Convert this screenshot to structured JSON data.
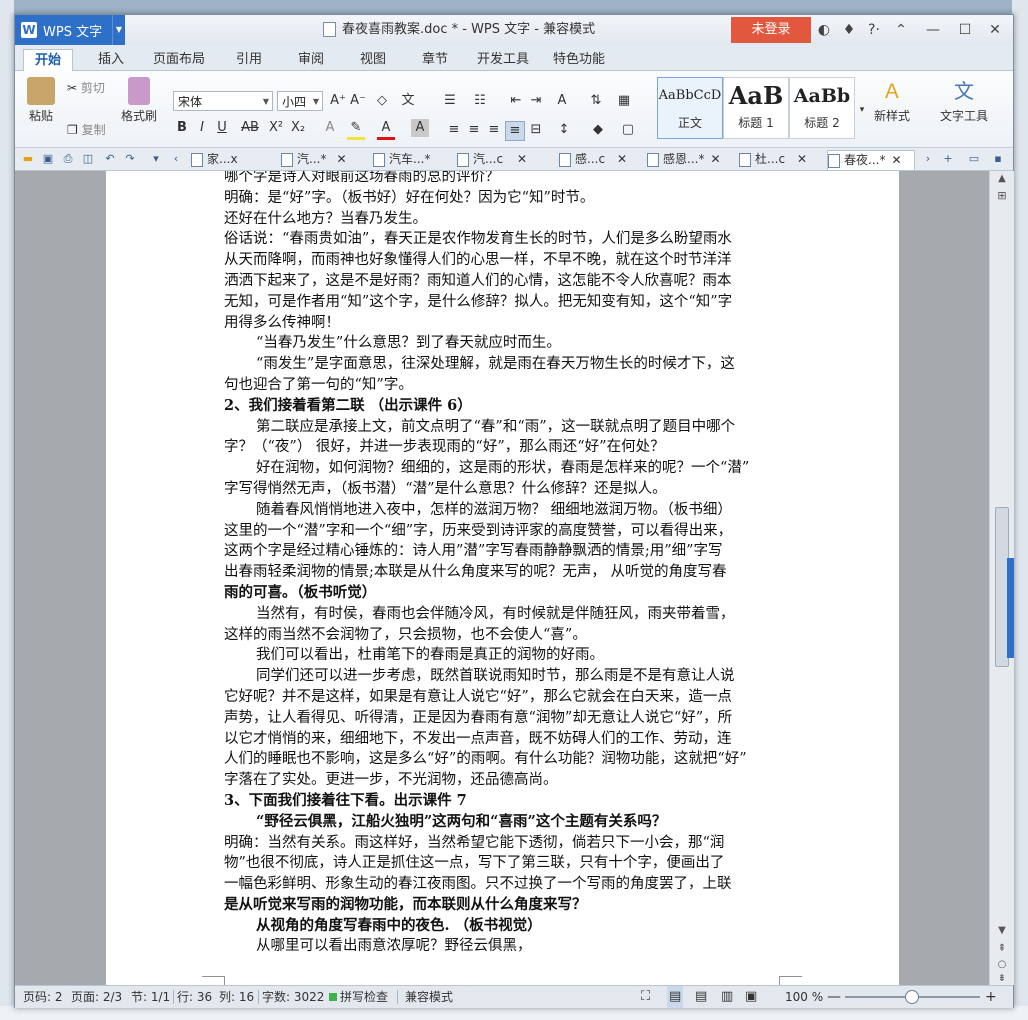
{
  "titlebar": {
    "app_name": "WPS 文字",
    "document_title": "春夜喜雨教案.doc * - WPS 文字 - 兼容模式",
    "login_label": "未登录"
  },
  "ribbon_tabs": [
    "开始",
    "插入",
    "页面布局",
    "引用",
    "审阅",
    "视图",
    "章节",
    "开发工具",
    "特色功能"
  ],
  "ribbon": {
    "paste": "粘贴",
    "cut": "剪切",
    "copy": "复制",
    "format_painter": "格式刷",
    "font_name": "宋体",
    "font_size": "小四",
    "styles": [
      {
        "sample": "AaBbCcD",
        "name": "正文"
      },
      {
        "sample": "AaB",
        "name": "标题 1"
      },
      {
        "sample": "AaBb",
        "name": "标题 2"
      }
    ],
    "new_style": "新样式",
    "text_tools": "文字工具"
  },
  "doc_tabs": [
    "家...x",
    "汽...*",
    "汽车...*",
    "汽...c",
    "感...c",
    "感恩...*",
    "杜...c",
    "春夜...*"
  ],
  "document": {
    "lines": [
      {
        "t": "哪个字是诗人对眼前这场春雨的总的评价？",
        "cls": ""
      },
      {
        "t": " 明确：是“好”字。（板书好）好在何处？因为它“知”时节。",
        "cls": ""
      },
      {
        "t": "还好在什么地方？当春乃发生。",
        "cls": ""
      },
      {
        "t": "俗话说：“春雨贵如油”，春天正是农作物发育生长的时节，人们是多么盼望雨水",
        "cls": ""
      },
      {
        "t": "从天而降啊，而雨神也好象懂得人们的心思一样，不早不晚，就在这个时节洋洋",
        "cls": ""
      },
      {
        "t": "洒洒下起来了，这是不是好雨？雨知道人们的心情，这怎能不令人欣喜呢？雨本",
        "cls": ""
      },
      {
        "t": "无知，可是作者用“知”这个字，是什么修辞？拟人。把无知变有知，这个“知”字",
        "cls": ""
      },
      {
        "t": "用得多么传神啊！",
        "cls": ""
      },
      {
        "t": "“当春乃发生”什么意思？到了春天就应时而生。",
        "cls": "ind"
      },
      {
        "t": "“雨发生”是字面意思，往深处理解，就是雨在春天万物生长的时候才下，这",
        "cls": "ind"
      },
      {
        "t": "句也迎合了第一句的“知”字。",
        "cls": ""
      },
      {
        "t": "2、我们接着看第二联 （出示课件 6）",
        "cls": "b"
      },
      {
        "t": "第二联应是承接上文，前文点明了“春”和“雨”，这一联就点明了题目中哪个",
        "cls": "ind"
      },
      {
        "t": "字？（“夜”）  很好，并进一步表现雨的“好”，那么雨还“好”在何处？",
        "cls": ""
      },
      {
        "t": "好在润物，如何润物？细细的，这是雨的形状，春雨是怎样来的呢？一个“潜”",
        "cls": "ind"
      },
      {
        "t": "字写得悄然无声，（板书潜）“潜”是什么意思？什么修辞？还是拟人。",
        "cls": ""
      },
      {
        "t": "随着春风悄悄地进入夜中，怎样的滋润万物？ 细细地滋润万物。（板书细）",
        "cls": "ind"
      },
      {
        "t": "这里的一个“潜”字和一个“细”字，历来受到诗评家的高度赞誉，可以看得出来，",
        "cls": ""
      },
      {
        "t": "这两个字是经过精心锤炼的：诗人用”潜”字写春雨静静飘洒的情景;用”细”字写",
        "cls": ""
      },
      {
        "t": "出春雨轻柔润物的情景;本联是从什么角度来写的呢？无声， 从听觉的角度写春",
        "cls": ""
      },
      {
        "t": "雨的可喜。（板书听觉）",
        "cls": "b"
      },
      {
        "t": "当然有，有时侯，春雨也会伴随冷风，有时候就是伴随狂风，雨夹带着雪，",
        "cls": "ind"
      },
      {
        "t": "这样的雨当然不会润物了，只会损物，也不会使人“喜”。",
        "cls": ""
      },
      {
        "t": "我们可以看出，杜甫笔下的春雨是真正的润物的好雨。",
        "cls": "ind"
      },
      {
        "t": "同学们还可以进一步考虑，既然首联说雨知时节，那么雨是不是有意让人说",
        "cls": "ind"
      },
      {
        "t": "它好呢？并不是这样，如果是有意让人说它“好”，那么它就会在白天来，造一点",
        "cls": ""
      },
      {
        "t": "声势，让人看得见、听得清，正是因为春雨有意“润物”却无意让人说它“好”，所",
        "cls": ""
      },
      {
        "t": "以它才悄悄的来，细细地下，不发出一点声音，既不妨碍人们的工作、劳动，连",
        "cls": ""
      },
      {
        "t": "人们的睡眠也不影响，这是多么“好”的雨啊。有什么功能？润物功能，这就把“好”",
        "cls": ""
      },
      {
        "t": "字落在了实处。更进一步，不光润物，还品德高尚。",
        "cls": ""
      },
      {
        "t": "3、下面我们接着往下看。出示课件 7",
        "cls": "b"
      },
      {
        "t": "“野径云俱黑，江船火独明”这两句和“喜雨”这个主题有关系吗？",
        "cls": "ind b"
      },
      {
        "t": "明确：当然有关系。雨这样好，当然希望它能下透彻，倘若只下一小会，那“润",
        "cls": ""
      },
      {
        "t": "物”也很不彻底，诗人正是抓住这一点，写下了第三联，只有十个字，便画出了",
        "cls": ""
      },
      {
        "t": "一幅色彩鲜明、形象生动的春江夜雨图。只不过换了一个写雨的角度罢了，上联",
        "cls": ""
      },
      {
        "t": "是从听觉来写雨的润物功能，而本联则从什么角度来写？",
        "cls": "b"
      },
      {
        "t": "从视角的角度写春雨中的夜色. （板书视觉）",
        "cls": "ind b"
      },
      {
        "t": "从哪里可以看出雨意浓厚呢？野径云俱黑，",
        "cls": "ind"
      }
    ]
  },
  "statusbar": {
    "page_no": "页码: 2",
    "pages": "页面: 2/3",
    "section": "节: 1/1",
    "row": "行: 36",
    "col": "列: 16",
    "word_count": "字数: 3022",
    "spell_check": "拼写检查",
    "compat_mode": "兼容模式",
    "zoom": "100 %"
  },
  "colors": {
    "accent": "#2e6fc8",
    "login": "#e2583f"
  }
}
